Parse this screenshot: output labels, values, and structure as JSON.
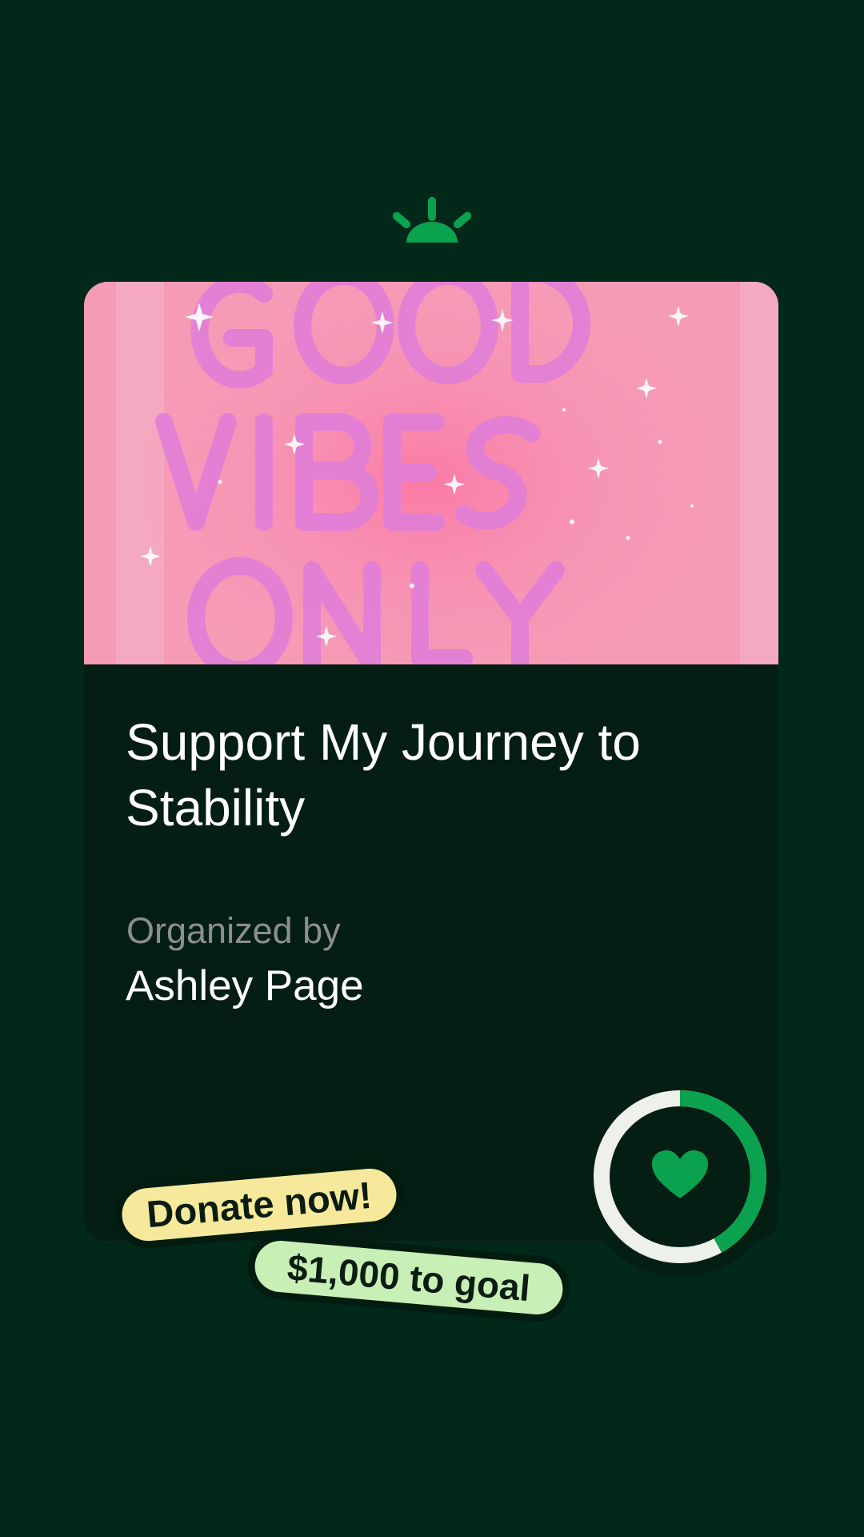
{
  "logo": {
    "icon": "sunrise-logo-icon",
    "color": "#0aa14f"
  },
  "card": {
    "image": {
      "description_text": [
        "GOOD",
        "VIBES",
        "ONLY"
      ]
    },
    "title": "Support My Journey to Stability",
    "organized_label": "Organized by",
    "organizer": "Ashley Page"
  },
  "progress": {
    "fraction": 0.42,
    "icon": "heart-icon",
    "accent": "#0aa14f"
  },
  "tags": {
    "donate": "Donate now!",
    "goal": "$1,000 to goal"
  },
  "colors": {
    "background": "#02281a",
    "card": "#041e13",
    "donate_tag": "#f6e99c",
    "goal_tag": "#c8f0b6"
  }
}
